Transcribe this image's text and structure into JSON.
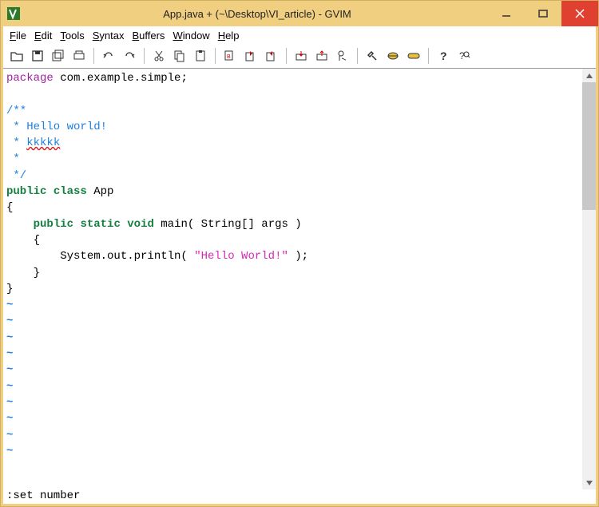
{
  "window": {
    "title": "App.java + (~\\Desktop\\VI_article) - GVIM"
  },
  "menu": {
    "file": "File",
    "edit": "Edit",
    "tools": "Tools",
    "syntax": "Syntax",
    "buffers": "Buffers",
    "window": "Window",
    "help": "Help"
  },
  "toolbar_icons": [
    "open",
    "save",
    "saveall",
    "print",
    "undo",
    "redo",
    "cut",
    "copy",
    "paste",
    "find-replace",
    "find-next",
    "find-prev",
    "load-session",
    "save-session",
    "run-script",
    "make",
    "shell",
    "tag-jump",
    "help",
    "find-help"
  ],
  "code": {
    "l1_kw": "package",
    "l1_rest": " com.example.simple;",
    "c_open": "/**",
    "c_hello": " * Hello world!",
    "c_kk_prefix": " * ",
    "c_kk_word": "kkkkk",
    "c_blank": " *",
    "c_close": " */",
    "l_pub": "public",
    "l_class": "class",
    "l_app": " App",
    "brace_open": "{",
    "m_pub": "public",
    "m_static": "static",
    "m_void": "void",
    "m_sig": " main( String[] args )",
    "body_brace_open": "    {",
    "body_print_pre": "        System.out.println( ",
    "body_str": "\"Hello World!\"",
    "body_print_post": " );",
    "body_brace_close": "    }",
    "brace_close": "}",
    "tilde": "~"
  },
  "status": ":set number"
}
